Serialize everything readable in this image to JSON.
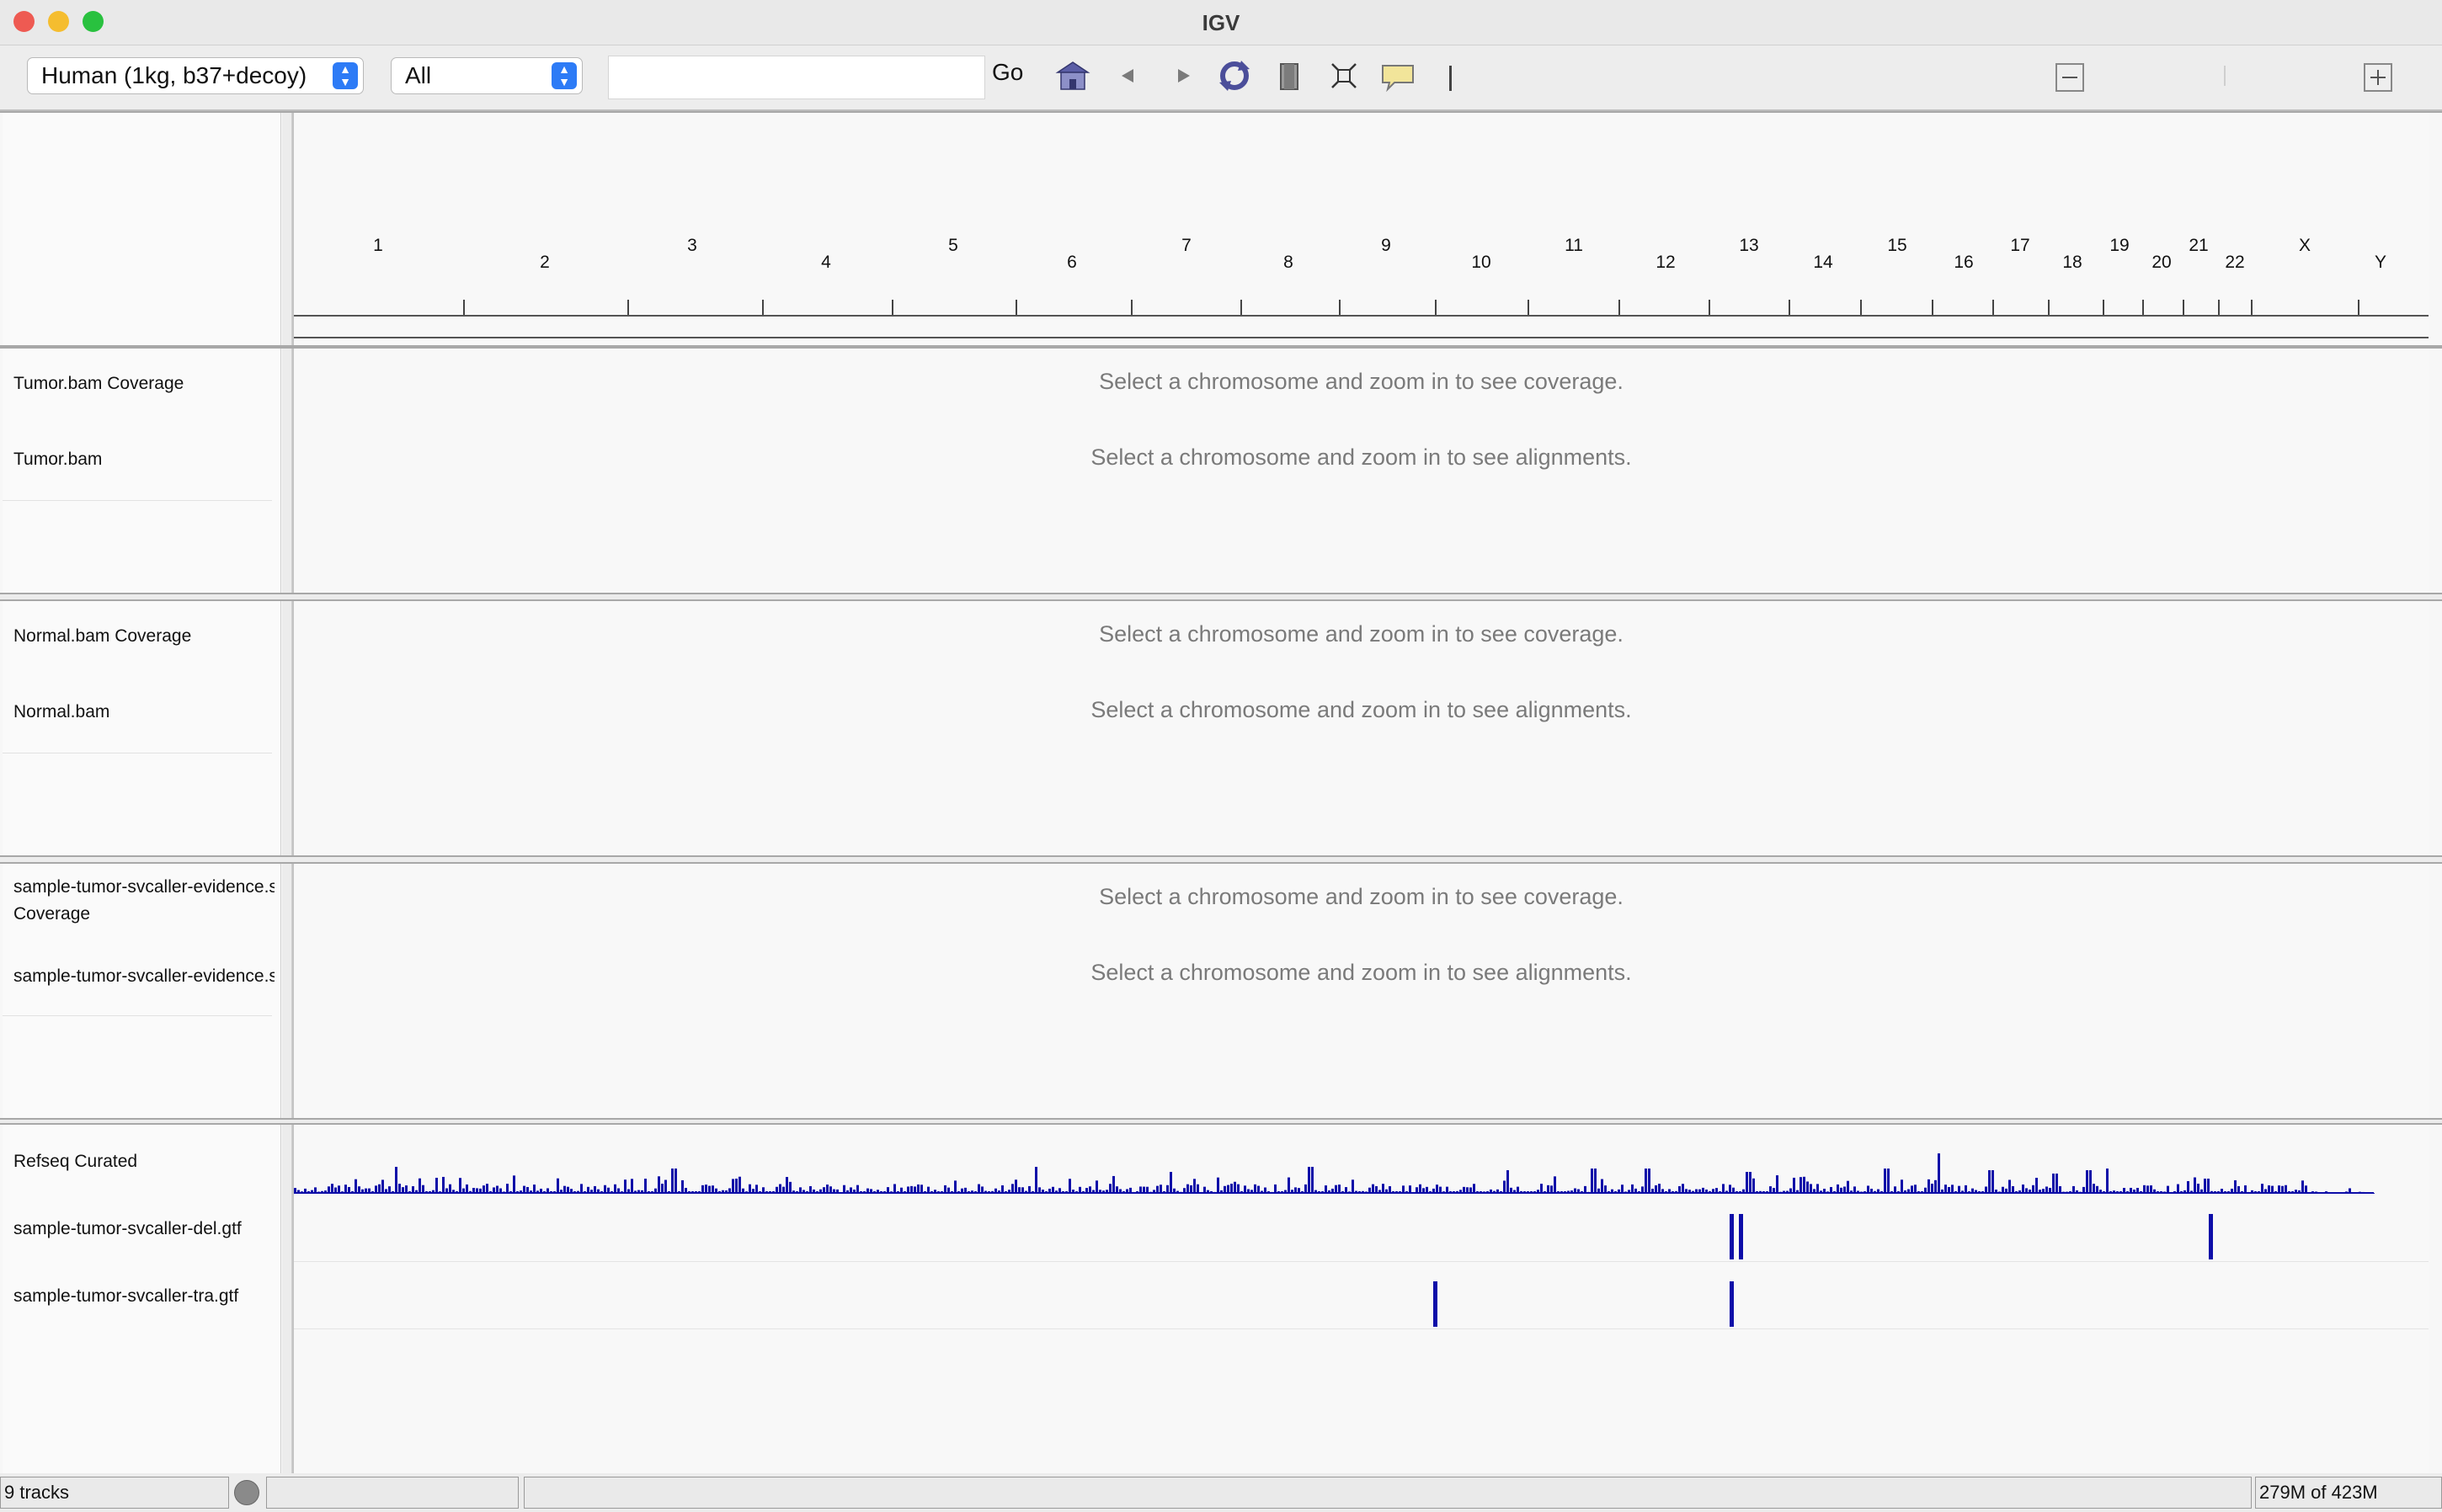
{
  "window": {
    "title": "IGV"
  },
  "toolbar": {
    "genome_select": "Human (1kg, b37+decoy)",
    "chromosome_select": "All",
    "locus_value": "",
    "go_label": "Go",
    "icons": [
      "home-icon",
      "back-icon",
      "forward-icon",
      "refresh-icon",
      "roi-icon",
      "fit-window-icon",
      "popup-info-icon"
    ]
  },
  "ruler": {
    "chromosomes": [
      "1",
      "2",
      "3",
      "4",
      "5",
      "6",
      "7",
      "8",
      "9",
      "10",
      "11",
      "12",
      "13",
      "14",
      "15",
      "16",
      "17",
      "18",
      "19",
      "20",
      "21",
      "22",
      "X",
      "Y"
    ]
  },
  "panels": [
    {
      "tracks": [
        {
          "name": "Tumor.bam Coverage",
          "message": "Select a chromosome and zoom in to see coverage."
        },
        {
          "name": "Tumor.bam",
          "message": "Select a chromosome and zoom in to see alignments."
        }
      ]
    },
    {
      "tracks": [
        {
          "name": "Normal.bam Coverage",
          "message": "Select a chromosome and zoom in to see coverage."
        },
        {
          "name": "Normal.bam",
          "message": "Select a chromosome and zoom in to see alignments."
        }
      ]
    },
    {
      "tracks": [
        {
          "name": "sample-tumor-svcaller-evidence.sorted.bam Coverage",
          "name_line1": "sample-tumor-svcaller-evidence.sc",
          "name_line2": "Coverage",
          "message": "Select a chromosome and zoom in to see coverage."
        },
        {
          "name": "sample-tumor-svcaller-evidence.sc",
          "message": "Select a chromosome and zoom in to see alignments."
        }
      ]
    }
  ],
  "feature_panel": {
    "tracks": [
      {
        "name": "Refseq Curated"
      },
      {
        "name": "sample-tumor-svcaller-del.gtf"
      },
      {
        "name": "sample-tumor-svcaller-tra.gtf"
      }
    ],
    "feature_color": "#0d0da8"
  },
  "status": {
    "tracks": "9 tracks",
    "memory": "279M of 423M"
  },
  "colors": {
    "accent": "#2d7bf6",
    "close": "#ee5a52",
    "minimize": "#f5bd2f",
    "maximize": "#29c13f"
  }
}
